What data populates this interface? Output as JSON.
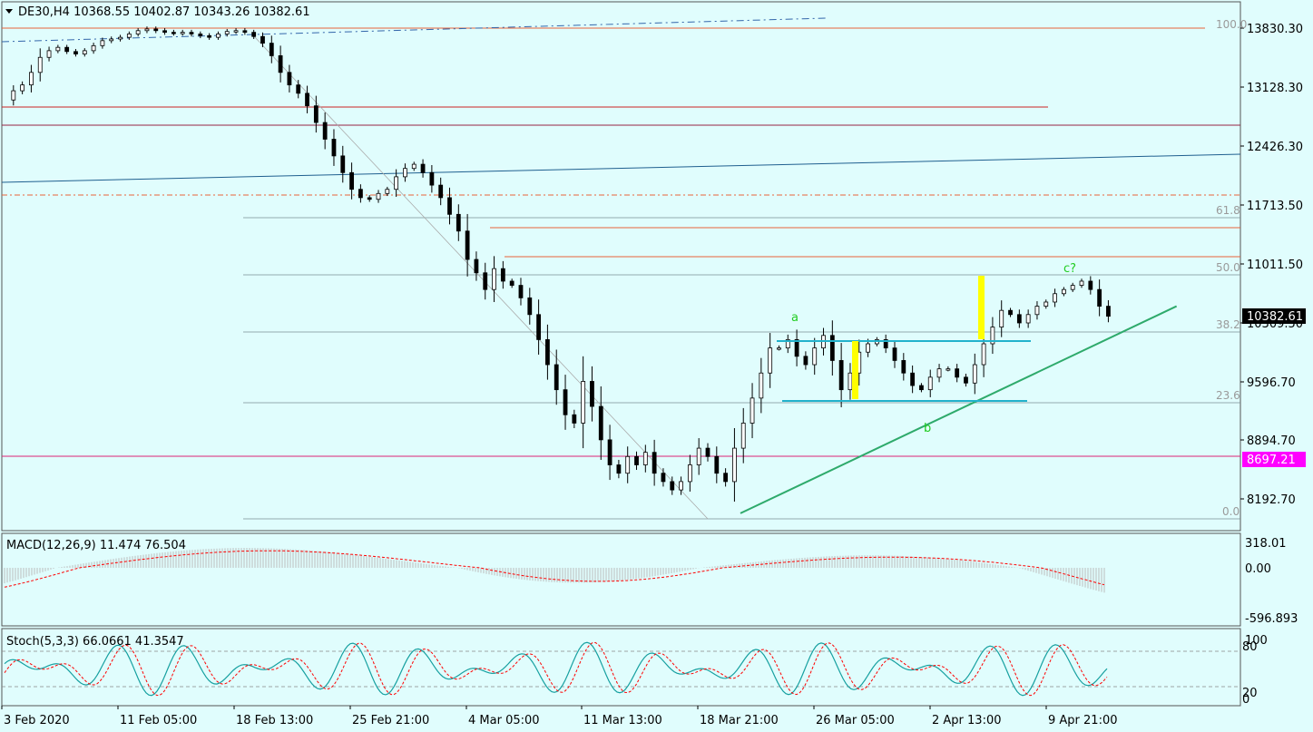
{
  "chart_data": [
    {
      "type": "candlestick",
      "header": "DE30,H4  10368.55 10402.87 10343.26 10382.61",
      "symbol": "DE30,H4",
      "ohlc": {
        "open": 10368.55,
        "high": 10402.87,
        "low": 10343.26,
        "close": 10382.61
      },
      "ylim": [
        7900,
        14000
      ],
      "y_ticks": [
        "13830.30",
        "13128.30",
        "12426.30",
        "11713.50",
        "11011.50",
        "10309.50",
        "9596.70",
        "8894.70",
        "8192.70"
      ],
      "x_ticks": [
        "3 Feb 2020",
        "11 Feb 05:00",
        "18 Feb 13:00",
        "25 Feb 21:00",
        "4 Mar 05:00",
        "11 Mar 13:00",
        "18 Mar 21:00",
        "26 Mar 05:00",
        "2 Apr 13:00",
        "9 Apr 21:00"
      ],
      "current_price_label": "10382.61",
      "level_label": "8697.21",
      "fib_labels": [
        "100.0",
        "61.8",
        "50.0",
        "38.2",
        "23.6",
        "0.0"
      ],
      "fib_levels": [
        13850,
        11580,
        10960,
        10340,
        9560,
        8000
      ],
      "wave_labels": [
        "a",
        "b",
        "c?"
      ],
      "close_path": [
        [
          0,
          12970
        ],
        [
          3,
          13080
        ],
        [
          6,
          13150
        ],
        [
          9,
          13300
        ],
        [
          12,
          13480
        ],
        [
          15,
          13560
        ],
        [
          18,
          13600
        ],
        [
          21,
          13550
        ],
        [
          24,
          13520
        ],
        [
          27,
          13560
        ],
        [
          30,
          13620
        ],
        [
          33,
          13680
        ],
        [
          36,
          13700
        ],
        [
          39,
          13720
        ],
        [
          42,
          13760
        ],
        [
          45,
          13800
        ],
        [
          48,
          13820
        ],
        [
          51,
          13800
        ],
        [
          54,
          13780
        ],
        [
          57,
          13770
        ],
        [
          60,
          13780
        ],
        [
          63,
          13760
        ],
        [
          66,
          13740
        ],
        [
          69,
          13720
        ],
        [
          72,
          13760
        ],
        [
          75,
          13790
        ],
        [
          78,
          13800
        ],
        [
          81,
          13780
        ],
        [
          84,
          13730
        ],
        [
          87,
          13650
        ],
        [
          90,
          13500
        ],
        [
          93,
          13300
        ],
        [
          96,
          13150
        ],
        [
          99,
          13050
        ],
        [
          102,
          12900
        ],
        [
          105,
          12700
        ],
        [
          108,
          12500
        ],
        [
          111,
          12300
        ],
        [
          114,
          12100
        ],
        [
          117,
          11900
        ],
        [
          120,
          11800
        ],
        [
          123,
          11780
        ],
        [
          126,
          11850
        ],
        [
          129,
          11900
        ],
        [
          132,
          12050
        ],
        [
          135,
          12150
        ],
        [
          138,
          12200
        ],
        [
          141,
          12100
        ],
        [
          144,
          11950
        ],
        [
          147,
          11800
        ],
        [
          150,
          11600
        ],
        [
          153,
          11400
        ],
        [
          156,
          11060
        ],
        [
          159,
          10900
        ],
        [
          162,
          10700
        ],
        [
          165,
          10950
        ],
        [
          168,
          10800
        ],
        [
          171,
          10750
        ],
        [
          174,
          10600
        ],
        [
          177,
          10400
        ],
        [
          180,
          10100
        ],
        [
          183,
          9800
        ],
        [
          186,
          9500
        ],
        [
          189,
          9200
        ],
        [
          192,
          9100
        ],
        [
          195,
          9600
        ],
        [
          198,
          9300
        ],
        [
          201,
          8900
        ],
        [
          204,
          8600
        ],
        [
          207,
          8500
        ],
        [
          210,
          8700
        ],
        [
          213,
          8600
        ],
        [
          216,
          8750
        ],
        [
          219,
          8500
        ],
        [
          222,
          8400
        ],
        [
          225,
          8300
        ],
        [
          228,
          8400
        ],
        [
          231,
          8600
        ],
        [
          234,
          8800
        ],
        [
          237,
          8700
        ],
        [
          240,
          8500
        ],
        [
          243,
          8400
        ],
        [
          246,
          8800
        ],
        [
          249,
          9100
        ],
        [
          252,
          9400
        ],
        [
          255,
          9700
        ],
        [
          258,
          10000
        ],
        [
          261,
          10000
        ],
        [
          264,
          10100
        ],
        [
          267,
          9900
        ],
        [
          270,
          9800
        ],
        [
          273,
          10000
        ],
        [
          276,
          10150
        ],
        [
          279,
          9850
        ],
        [
          282,
          9500
        ],
        [
          285,
          9700
        ],
        [
          288,
          9950
        ],
        [
          291,
          10050
        ],
        [
          294,
          10100
        ],
        [
          297,
          10000
        ],
        [
          300,
          9850
        ],
        [
          303,
          9700
        ],
        [
          306,
          9550
        ],
        [
          309,
          9500
        ],
        [
          312,
          9650
        ],
        [
          315,
          9750
        ],
        [
          318,
          9750
        ],
        [
          321,
          9650
        ],
        [
          324,
          9580
        ],
        [
          327,
          9800
        ],
        [
          330,
          10050
        ],
        [
          333,
          10250
        ],
        [
          336,
          10450
        ],
        [
          339,
          10400
        ],
        [
          342,
          10300
        ],
        [
          345,
          10400
        ],
        [
          348,
          10500
        ],
        [
          351,
          10550
        ],
        [
          354,
          10650
        ],
        [
          357,
          10700
        ],
        [
          360,
          10750
        ],
        [
          363,
          10800
        ],
        [
          366,
          10700
        ],
        [
          369,
          10500
        ],
        [
          372,
          10380
        ]
      ],
      "trendline": {
        "from": [
          248,
          8020
        ],
        "to": [
          395,
          10500
        ]
      }
    },
    {
      "type": "line",
      "title": "MACD(12,26,9) 11.474 76.504",
      "y_ticks": [
        "318.01",
        "0.00",
        "-596.893"
      ],
      "ylim": [
        -596.893,
        318.01
      ]
    },
    {
      "type": "line",
      "title": "Stoch(5,3,3) 66.0661 41.3547",
      "y_ticks": [
        "100",
        "80",
        "20",
        "0"
      ],
      "ylim": [
        0,
        100
      ]
    }
  ],
  "colors": {
    "background": "#e0fdfd",
    "bull": "#ffffff",
    "bear": "#000000",
    "current_price_bg": "#000000",
    "level_bg": "#ff00ff",
    "trend": "#2eaa6b",
    "box": "#22b2cc",
    "highlight": "#ffff00",
    "macd_signal": "#ff0000",
    "stoch_main": "#16a0a0"
  }
}
